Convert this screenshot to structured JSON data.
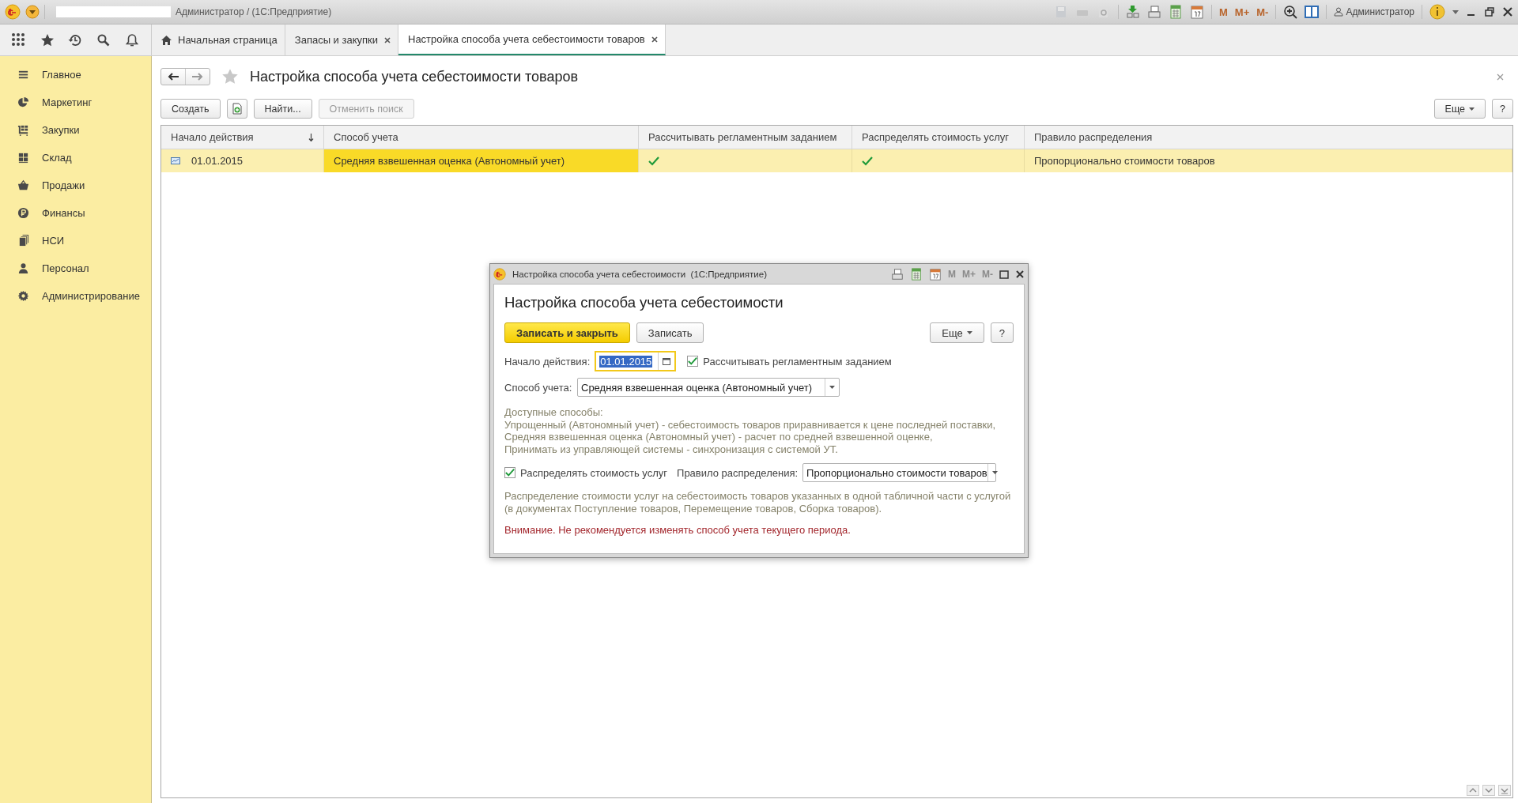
{
  "window": {
    "title": "Администратор / (1С:Предприятие)",
    "user": "Администратор",
    "memory_buttons": [
      "M",
      "M+",
      "M-"
    ]
  },
  "tabs": [
    {
      "label": "Начальная страница",
      "selected": false
    },
    {
      "label": "Запасы и закупки",
      "selected": false
    },
    {
      "label": "Настройка способа учета себестоимости товаров",
      "selected": true
    }
  ],
  "sidebar": {
    "items": [
      {
        "label": "Главное"
      },
      {
        "label": "Маркетинг"
      },
      {
        "label": "Закупки"
      },
      {
        "label": "Склад"
      },
      {
        "label": "Продажи"
      },
      {
        "label": "Финансы"
      },
      {
        "label": "НСИ"
      },
      {
        "label": "Персонал"
      },
      {
        "label": "Администрирование"
      }
    ]
  },
  "form": {
    "title": "Настройка способа учета себестоимости товаров",
    "buttons": [
      {
        "label": "Создать",
        "disabled": false
      },
      {
        "label": "Найти...",
        "disabled": false
      },
      {
        "label": "Отменить поиск",
        "disabled": true
      }
    ],
    "more": "Еще",
    "help": "?"
  },
  "table": {
    "columns": [
      {
        "label": "Начало действия",
        "sorted": true
      },
      {
        "label": "Способ учета",
        "sorted": false
      },
      {
        "label": "Рассчитывать регламентным заданием",
        "sorted": false
      },
      {
        "label": "Распределять стоимость услуг",
        "sorted": false
      },
      {
        "label": "Правило распределения",
        "sorted": false
      }
    ],
    "rows": [
      {
        "selected": true,
        "date": "01.01.2015",
        "method": "Средняя взвешенная оценка (Автономный учет)",
        "scheduled": true,
        "distribute": true,
        "rule": "Пропорционально стоимости товаров"
      }
    ]
  },
  "dialog": {
    "window_title": "Настройка способа учета себестоимости  (1С:Предприятие)",
    "memory_buttons": [
      "M",
      "M+",
      "M-"
    ],
    "title": "Настройка способа учета себестоимости",
    "buttons": [
      {
        "label": "Записать и закрыть",
        "kind": "primary"
      },
      {
        "label": "Записать",
        "kind": "default"
      }
    ],
    "more": "Еще",
    "help": "?",
    "start_label": "Начало действия:",
    "start_value": "01.01.2015",
    "scheduled": {
      "label": "Рассчитывать регламентным заданием",
      "checked": true
    },
    "method_label": "Способ учета:",
    "method_value": "Средняя взвешенная оценка (Автономный учет)",
    "help_lines": [
      "Доступные способы:",
      "Упрощенный (Автономный учет) - себестоимость товаров приравнивается к цене последней поставки,",
      "Средняя взвешенная оценка (Автономный учет) - расчет по средней взвешенной оценке,",
      "Принимать из управляющей системы - синхронизация с системой УТ."
    ],
    "distribute": {
      "label": "Распределять стоимость услуг",
      "checked": true
    },
    "rule_label": "Правило распределения:",
    "rule_value": "Пропорционально стоимости товаров",
    "note_lines": [
      "Распределение стоимости услуг на себестоимость товаров указанных в одной табличной части с услугой",
      "(в документах Поступление товаров, Перемещение товаров, Сборка товаров)."
    ],
    "warning": "Внимание. Не рекомендуется изменять способ учета текущего периода."
  }
}
